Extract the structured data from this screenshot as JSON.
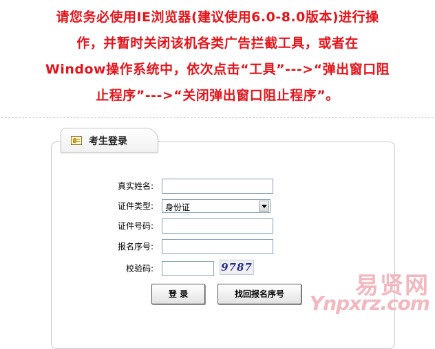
{
  "notice": {
    "lines": [
      "请您务必使用IE浏览器(建议使用6.0-8.0版本)进行操",
      "作，并暂时关闭该机各类广告拦截工具，或者在",
      "Window操作系统中，依次点击“工具”--->“弹出窗口阻",
      "止程序”--->“关闭弹出窗口阻止程序”。"
    ],
    "color": "#e5141b"
  },
  "panel": {
    "title": "考生登录",
    "icon": "id-card-icon"
  },
  "form": {
    "name_label": "真实姓名:",
    "name_value": "",
    "id_type_label": "证件类型:",
    "id_type_value": "身份证",
    "id_number_label": "证件号码:",
    "id_number_value": "",
    "reg_number_label": "报名序号:",
    "reg_number_value": "",
    "captcha_label": "校验码:",
    "captcha_value": "",
    "captcha_image_text": "9787"
  },
  "buttons": {
    "login": "登 录",
    "recover": "找回报名序号"
  },
  "watermark": {
    "cn": "易贤网",
    "en": "Ynpxrz.com"
  }
}
